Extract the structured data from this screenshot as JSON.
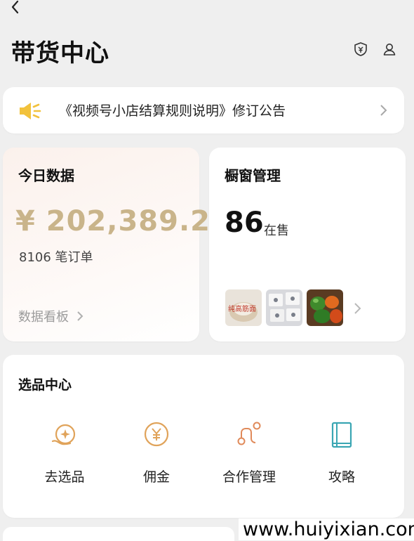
{
  "header": {
    "title": "带货中心"
  },
  "notice": {
    "text": "《视频号小店结算规则说明》修订公告"
  },
  "today_data": {
    "title": "今日数据",
    "amount": "¥ 202,389.2",
    "orders": "8106 笔订单",
    "dashboard_link": "数据看板"
  },
  "showcase": {
    "title": "橱窗管理",
    "count": "86",
    "unit": "在售",
    "thumbnails": [
      {
        "icon": "flour-product-thumbnail",
        "caption": "纯高筋面"
      },
      {
        "icon": "packaged-snack-thumbnail"
      },
      {
        "icon": "peppers-product-thumbnail"
      }
    ]
  },
  "selection_center": {
    "title": "选品中心",
    "entries": [
      {
        "label": "去选品",
        "icon": "select-products-icon"
      },
      {
        "label": "佣金",
        "icon": "commission-yen-icon"
      },
      {
        "label": "合作管理",
        "icon": "cooperation-management-icon"
      },
      {
        "label": "攻略",
        "icon": "guide-book-icon"
      }
    ]
  },
  "watermark": "www.huiyixian.com",
  "colors": {
    "accent_gold": "#c9b48a",
    "icon_orange": "#e0a35a",
    "icon_teal": "#3aa6b3",
    "speaker_yellow": "#f2c23c"
  }
}
